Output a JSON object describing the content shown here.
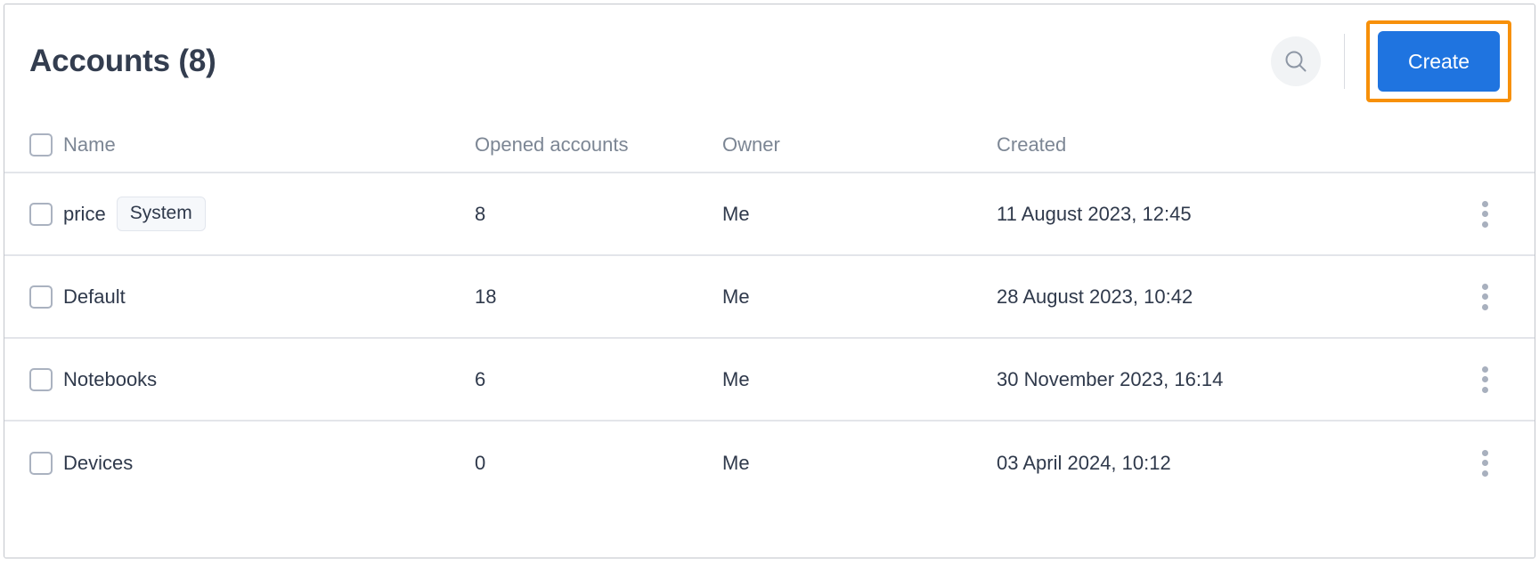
{
  "header": {
    "title": "Accounts (8)",
    "search_icon": "search-icon",
    "create_label": "Create",
    "highlight_color": "#f79009",
    "create_color": "#1f74e0"
  },
  "table": {
    "columns": [
      "Name",
      "Opened accounts",
      "Owner",
      "Created"
    ],
    "rows": [
      {
        "name": "price",
        "badge": "System",
        "opened_accounts": "8",
        "owner": "Me",
        "created": "11 August 2023, 12:45"
      },
      {
        "name": "Default",
        "badge": "",
        "opened_accounts": "18",
        "owner": "Me",
        "created": "28 August 2023, 10:42"
      },
      {
        "name": "Notebooks",
        "badge": "",
        "opened_accounts": "6",
        "owner": "Me",
        "created": "30 November 2023, 16:14"
      },
      {
        "name": "Devices",
        "badge": "",
        "opened_accounts": "0",
        "owner": "Me",
        "created": "03 April 2024, 10:12"
      }
    ]
  }
}
